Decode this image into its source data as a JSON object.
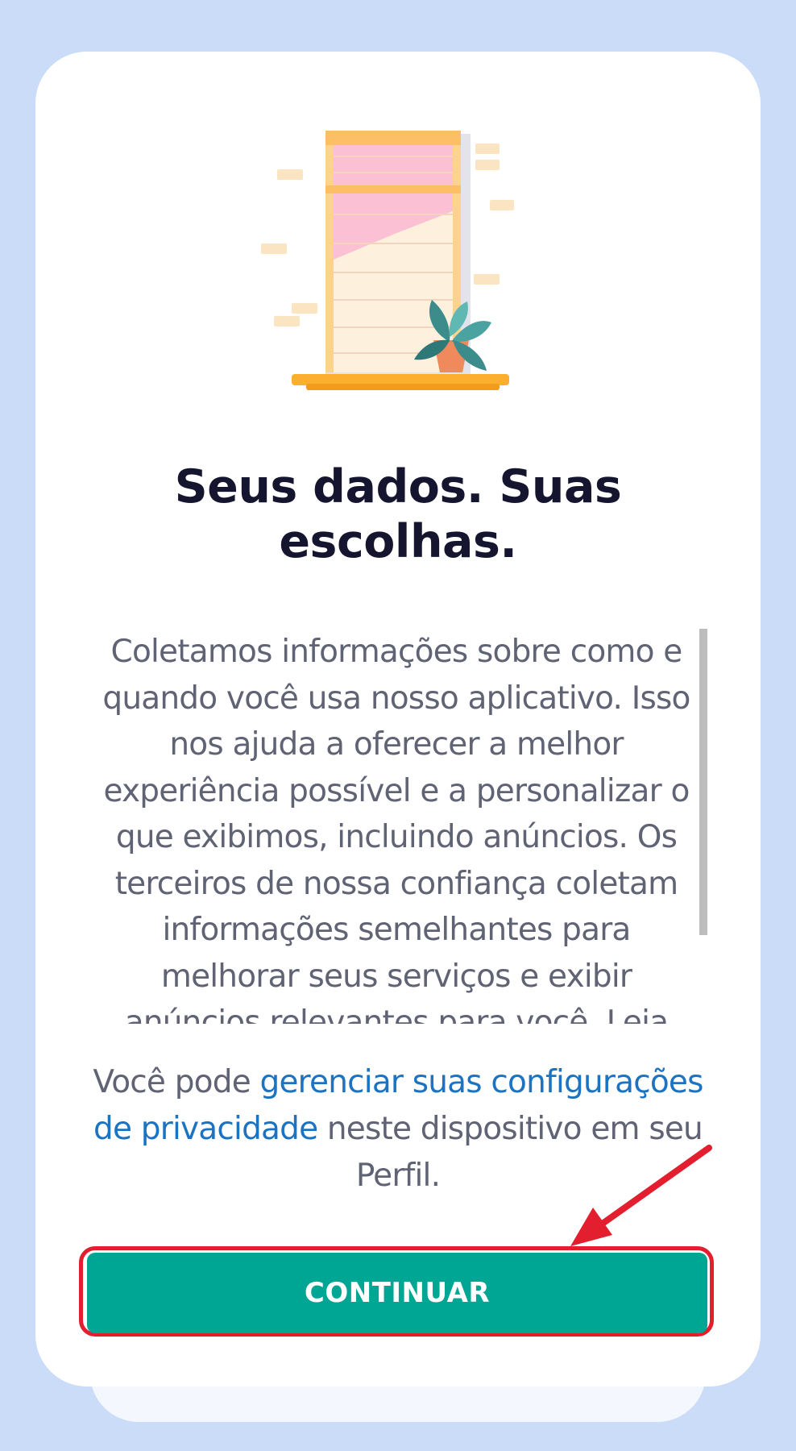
{
  "dialog": {
    "title": "Seus dados. Suas escolhas.",
    "body": "Coletamos informações sobre como e quando você usa nosso aplicativo. Isso nos ajuda a oferecer a melhor experiência possível e a personalizar o que exibimos, incluindo anúncios. Os terceiros de nossa confiança coletam informações semelhantes para melhorar seus serviços e exibir anúncios relevantes para você. Leia",
    "note_prefix": "Você pode ",
    "note_link": "gerenciar suas configurações de privacidade",
    "note_suffix": " neste dispositivo em seu Perfil.",
    "continue_label": "CONTINUAR"
  },
  "colors": {
    "background": "#cadcf7",
    "button": "#00a694",
    "link": "#1b73c2",
    "highlight": "#e31e2e"
  }
}
